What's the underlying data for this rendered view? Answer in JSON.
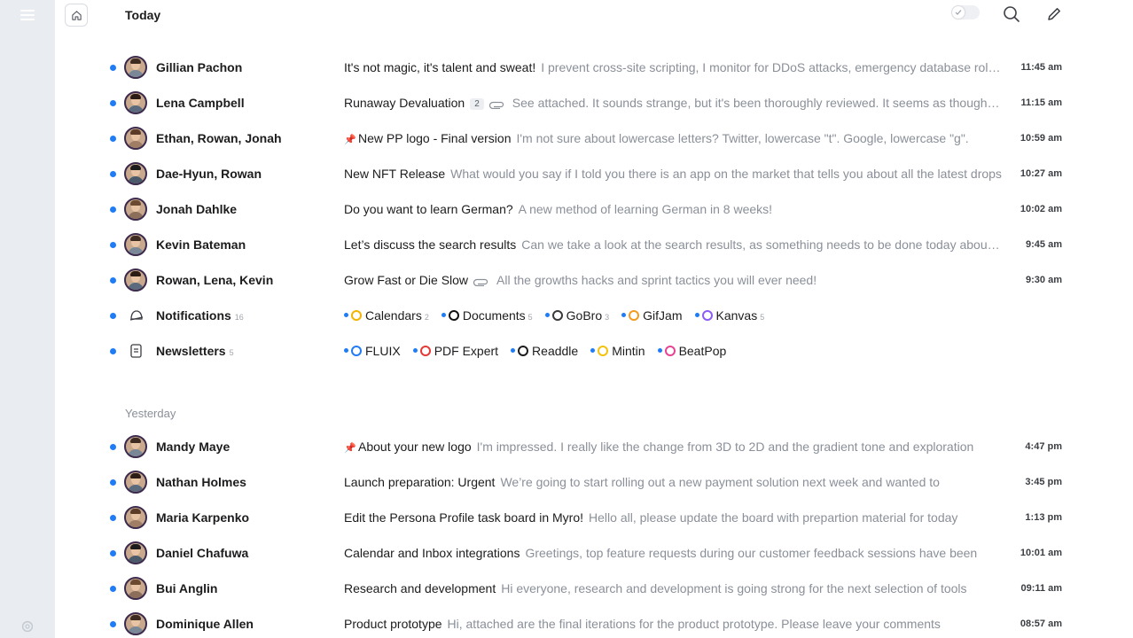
{
  "header": {
    "title": "Today"
  },
  "sections": {
    "today": "Today",
    "yesterday": "Yesterday"
  },
  "today": [
    {
      "sender": "Gillian Pachon",
      "subject": "It's not magic, it's talent and sweat!",
      "preview": "I prevent cross-site scripting, I monitor for DDoS attacks, emergency database rollbacks, and faulty transaction handlings.",
      "time": "11:45 am"
    },
    {
      "sender": "Lena Campbell",
      "subject": "Runaway Devaluation",
      "badge": "2",
      "preview": "See attached. It sounds strange, but it's been thoroughly reviewed. It seems as though the market",
      "time": "11:15 am"
    },
    {
      "sender": "Ethan, Rowan, Jonah",
      "subject": "New PP logo - Final version",
      "preview": "I'm not sure about lowercase letters? Twitter, lowercase \"t\". Google, lowercase \"g\".",
      "time": "10:59 am"
    },
    {
      "sender": "Dae-Hyun, Rowan",
      "subject": "New NFT Release",
      "preview": "What would you say if I told you there is an app on the market that tells you about all the latest drops",
      "time": "10:27 am"
    },
    {
      "sender": "Jonah Dahlke",
      "subject": "Do you want to learn German?",
      "preview": "A new method of learning German in 8 weeks!",
      "time": "10:02 am"
    },
    {
      "sender": "Kevin Bateman",
      "subject": "Let’s discuss the search results",
      "preview": "Can we take a look at the search results, as something needs to be done today about them",
      "time": "9:45 am"
    },
    {
      "sender": "Rowan, Lena, Kevin",
      "subject": "Grow Fast or Die Slow",
      "preview": "All the growths hacks and sprint tactics you will ever need!",
      "time": "9:30 am"
    }
  ],
  "notifications": {
    "label": "Notifications",
    "count": "16",
    "items": [
      {
        "name": "Calendars",
        "count": "2",
        "color": "#f4b400"
      },
      {
        "name": "Documents",
        "count": "5",
        "color": "#111111"
      },
      {
        "name": "GoBro",
        "count": "3",
        "color": "#3a3a3a"
      },
      {
        "name": "GifJam",
        "count": "",
        "color": "#f29c1f"
      },
      {
        "name": "Kanvas",
        "count": "5",
        "color": "#8b5cf6"
      }
    ]
  },
  "newsletters": {
    "label": "Newsletters",
    "count": "5",
    "items": [
      {
        "name": "FLUIX",
        "color": "#1f7cf5"
      },
      {
        "name": "PDF Expert",
        "color": "#e53935"
      },
      {
        "name": "Readdle",
        "color": "#1c1c1e"
      },
      {
        "name": "Mintin",
        "color": "#f4c20d"
      },
      {
        "name": "BeatPop",
        "color": "#e84393"
      }
    ]
  },
  "yesterday": [
    {
      "sender": "Mandy Maye",
      "subject": "About your new logo",
      "preview": "I'm impressed. I really like the change from 3D to 2D and the gradient tone and exploration",
      "time": "4:47 pm"
    },
    {
      "sender": "Nathan Holmes",
      "subject": "Launch preparation: Urgent",
      "preview": "We’re going to start rolling out a new payment solution next week and wanted to",
      "time": "3:45 pm"
    },
    {
      "sender": "Maria Karpenko",
      "subject": "Edit the Persona Profile task board in Myro!",
      "preview": "Hello all, please update the board with prepartion material for today",
      "time": "1:13 pm"
    },
    {
      "sender": "Daniel Chafuwa",
      "subject": "Calendar and Inbox integrations",
      "preview": "Greetings, top feature requests during our customer feedback sessions have been",
      "time": "10:01 am"
    },
    {
      "sender": "Bui Anglin",
      "subject": "Research and development",
      "preview": "Hi everyone, research and development is going strong for the next selection of tools",
      "time": "09:11 am"
    },
    {
      "sender": "Dominique Allen",
      "subject": "Product prototype",
      "preview": "Hi, attached are the final iterations for the product prototype. Please leave your comments",
      "time": "08:57 am"
    }
  ],
  "icons": {
    "menu": "hamburger-menu-icon",
    "home": "home-icon",
    "search": "search-icon",
    "compose": "compose-icon",
    "settings": "gear-icon",
    "pin": "pin-icon",
    "clip": "paperclip-icon"
  }
}
